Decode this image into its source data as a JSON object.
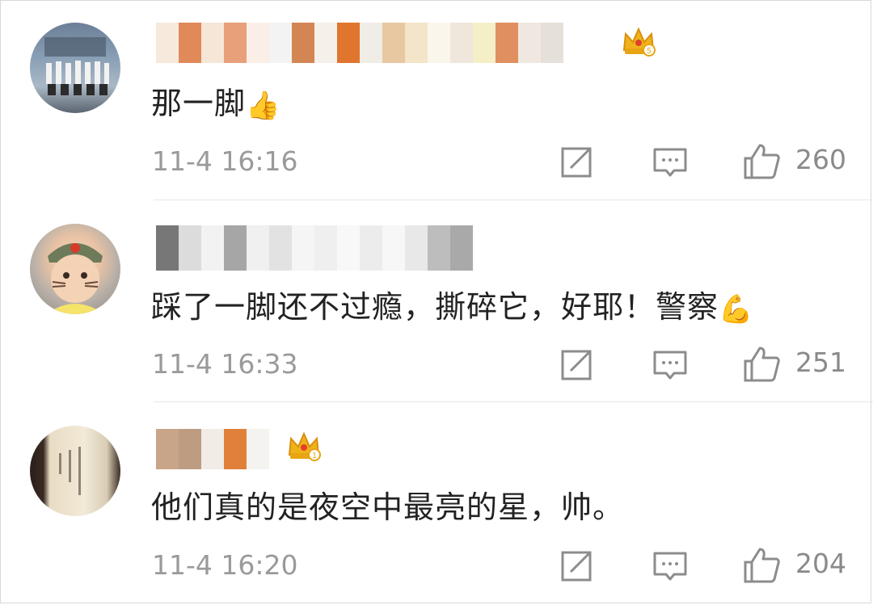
{
  "comments": [
    {
      "text": "那一脚",
      "emoji": "👍",
      "time": "11-4 16:16",
      "likes": "260",
      "crown_level": "5"
    },
    {
      "text": "踩了一脚还不过瘾，撕碎它，好耶！警察",
      "emoji": "💪",
      "time": "11-4 16:33",
      "likes": "251"
    },
    {
      "text": "他们真的是夜空中最亮的星，帅。",
      "time": "11-4 16:20",
      "likes": "204",
      "crown_level": "1"
    }
  ],
  "icons": {
    "share": "share-icon",
    "reply": "comment-icon",
    "like": "thumb-up-icon",
    "crown": "crown-badge-icon"
  },
  "colors": {
    "text": "#222222",
    "meta": "#9a9a9a",
    "crown": "#f0b21a"
  }
}
